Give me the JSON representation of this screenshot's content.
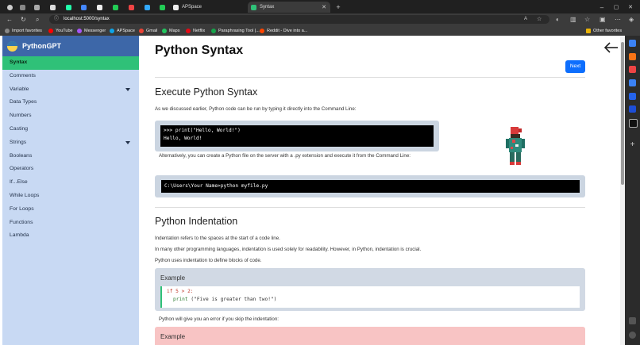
{
  "browser": {
    "tabs": [
      {
        "label": "APSpace"
      },
      {
        "label": "Syntax"
      }
    ],
    "address": {
      "url": "localhost:5000/syntax"
    },
    "favorites": [
      {
        "label": "Import favorites",
        "color": "#888888"
      },
      {
        "label": "YouTube",
        "color": "#ff0000"
      },
      {
        "label": "Messenger",
        "color": "#a855f7"
      },
      {
        "label": "APSpace",
        "color": "#0ea5e9"
      },
      {
        "label": "Gmail",
        "color": "#ea4335"
      },
      {
        "label": "Maps",
        "color": "#22c55e"
      },
      {
        "label": "Netflix",
        "color": "#e50914"
      },
      {
        "label": "Paraphrasing Tool |...",
        "color": "#16a34a"
      },
      {
        "label": "Reddit - Dive into a...",
        "color": "#ff4500"
      }
    ],
    "other_favorites": "Other favorites"
  },
  "sidebar": {
    "brand": "PythonGPT",
    "items": [
      {
        "label": "Syntax"
      },
      {
        "label": "Comments"
      },
      {
        "label": "Variable"
      },
      {
        "label": "Data Types"
      },
      {
        "label": "Numbers"
      },
      {
        "label": "Casting"
      },
      {
        "label": "Strings"
      },
      {
        "label": "Booleans"
      },
      {
        "label": "Operators"
      },
      {
        "label": "If...Else"
      },
      {
        "label": "While Loops"
      },
      {
        "label": "For Loops"
      },
      {
        "label": "Functions"
      },
      {
        "label": "Lambda"
      }
    ]
  },
  "main": {
    "title": "Python Syntax",
    "next_label": "Next",
    "section1": {
      "heading": "Execute Python Syntax",
      "intro": "As we discussed earlier, Python code can be run by typing it directly into the Command Line:",
      "code1_line1": ">>> print(\"Hello, World!\")",
      "code1_line2": "Hello, World!",
      "alt": "Alternatively, you can create a Python file on the server with a .py extension and execute it from the Command Line:",
      "code2": "C:\\Users\\Your Name>python myfile.py"
    },
    "section2": {
      "heading": "Python Indentation",
      "p1": "Indentation refers to the spaces at the start of a code line.",
      "p2": "In many other programming languages, indentation is used solely for readability. However, in Python, indentation is crucial.",
      "p3": "Python uses indentation to define blocks of code.",
      "example_title": "Example",
      "code_if": "if",
      "code_cond": " 5 > 2:",
      "code_print": "print",
      "code_str": " (\"Five is greater than two!\")",
      "error_text": "Python will give you an error if you skip the indentation:",
      "example2_title": "Example"
    }
  }
}
